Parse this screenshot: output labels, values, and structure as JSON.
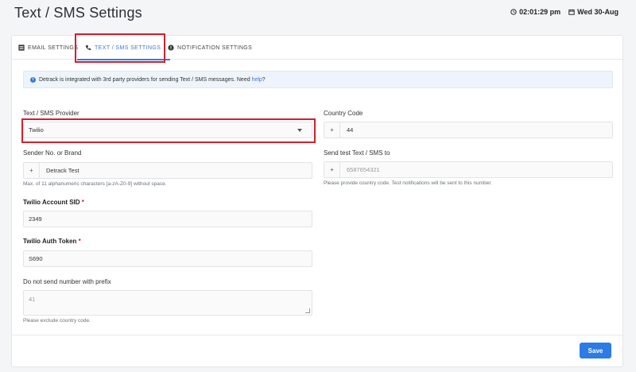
{
  "page": {
    "title": "Text / SMS Settings"
  },
  "clock": {
    "time": "02:01:29 pm",
    "date": "Wed 30-Aug"
  },
  "tabs": [
    {
      "label": "EMAIL SETTINGS",
      "icon": "list-icon"
    },
    {
      "label": "TEXT / SMS SETTINGS",
      "icon": "phone-icon",
      "active": true
    },
    {
      "label": "NOTIFICATION SETTINGS",
      "icon": "alert-icon"
    }
  ],
  "info": {
    "text": "Detrack is integrated with 3rd party providers for sending Text / SMS messages. Need ",
    "link": "help",
    "suffix": "?"
  },
  "form": {
    "provider": {
      "label": "Text / SMS Provider",
      "value": "Twilio"
    },
    "sender": {
      "label": "Sender No. or Brand",
      "prefix": "+",
      "value": "Detrack Test",
      "hint": "Max. of 11 alphanumeric characters [a-zA-Z0-9] without space."
    },
    "account_sid": {
      "label": "Twilio Account SID",
      "required": "*",
      "value": "2349"
    },
    "auth_token": {
      "label": "Twilio Auth Token",
      "required": "*",
      "value": "S690"
    },
    "exclude_prefix": {
      "label": "Do not send number with prefix",
      "placeholder": "41",
      "hint": "Please exclude country code."
    },
    "country_code": {
      "label": "Country Code",
      "prefix": "+",
      "value": "44"
    },
    "test_number": {
      "label": "Send test Text / SMS to",
      "prefix": "+",
      "placeholder": "6587654321",
      "hint": "Please provide country code. Test notifications will be sent to this number."
    }
  },
  "footer": {
    "save_label": "Save"
  },
  "colors": {
    "accent": "#3c7bd9",
    "highlight": "#d0202e",
    "button": "#2d7be5"
  }
}
